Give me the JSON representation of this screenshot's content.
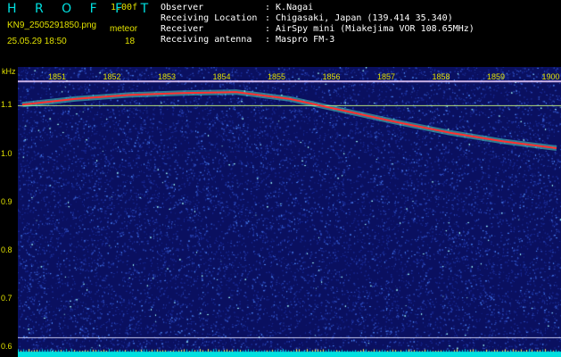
{
  "header": {
    "brand": "H R O F F T",
    "version": "1.00f",
    "filename": "KN9_2505291850.png",
    "datetime": "25.05.29 18:50",
    "meteor_label": "meteor",
    "meteor_count": "18"
  },
  "info": [
    {
      "key": "Observer",
      "value": ": K.Nagai"
    },
    {
      "key": "Receiving Location",
      "value": ": Chigasaki, Japan (139.414 35.340)"
    },
    {
      "key": "Receiver",
      "value": ": AirSpy mini (Miakejima VOR 108.65MHz)"
    },
    {
      "key": "Receiving antenna",
      "value": ": Maspro FM-3"
    }
  ],
  "spectrogram": {
    "unit": "kHz",
    "y_ticks": [
      "1.1",
      "1.0",
      "0.9",
      "0.8",
      "0.7",
      "0.6"
    ],
    "x_ticks": [
      "1851",
      "1852",
      "1853",
      "1854",
      "1855",
      "1856",
      "1857",
      "1858",
      "1859",
      "1900"
    ],
    "y_range_khz": [
      0.58,
      1.18
    ],
    "x_range_minutes": [
      0,
      10
    ],
    "signal_trace_khz": [
      {
        "t": 0,
        "f": 1.102
      },
      {
        "t": 1,
        "f": 1.114
      },
      {
        "t": 2,
        "f": 1.122
      },
      {
        "t": 3,
        "f": 1.126
      },
      {
        "t": 4,
        "f": 1.128
      },
      {
        "t": 5,
        "f": 1.114
      },
      {
        "t": 6,
        "f": 1.09
      },
      {
        "t": 7,
        "f": 1.066
      },
      {
        "t": 8,
        "f": 1.044
      },
      {
        "t": 9,
        "f": 1.026
      },
      {
        "t": 10,
        "f": 1.012
      }
    ],
    "horizontal_lines_khz": [
      1.15,
      1.1,
      0.62
    ],
    "colors": {
      "background": "#0a1060",
      "noise": "#3050c0",
      "signal": "#ff3030",
      "line": "#e0e0ff",
      "text": "#e0e000",
      "floor": "#00e0e0"
    }
  }
}
